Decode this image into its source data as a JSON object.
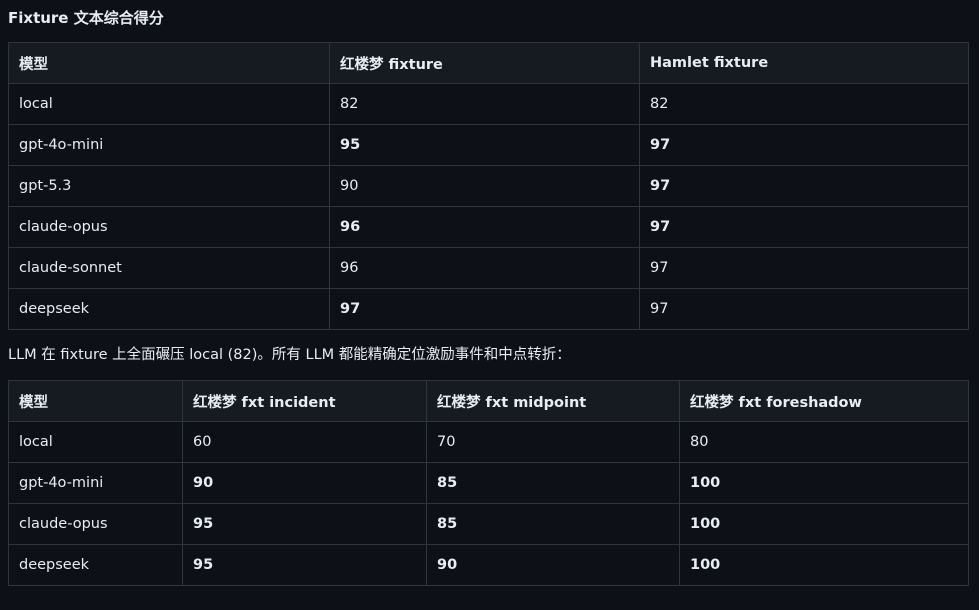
{
  "heading": "Fixture 文本综合得分",
  "table1": {
    "headers": [
      "模型",
      "红楼梦 fixture",
      "Hamlet fixture"
    ],
    "rows": [
      [
        {
          "v": "local",
          "b": false
        },
        {
          "v": "82",
          "b": false
        },
        {
          "v": "82",
          "b": false
        }
      ],
      [
        {
          "v": "gpt-4o-mini",
          "b": false
        },
        {
          "v": "95",
          "b": true
        },
        {
          "v": "97",
          "b": true
        }
      ],
      [
        {
          "v": "gpt-5.3",
          "b": false
        },
        {
          "v": "90",
          "b": false
        },
        {
          "v": "97",
          "b": true
        }
      ],
      [
        {
          "v": "claude-opus",
          "b": false
        },
        {
          "v": "96",
          "b": true
        },
        {
          "v": "97",
          "b": true
        }
      ],
      [
        {
          "v": "claude-sonnet",
          "b": false
        },
        {
          "v": "96",
          "b": false
        },
        {
          "v": "97",
          "b": false
        }
      ],
      [
        {
          "v": "deepseek",
          "b": false
        },
        {
          "v": "97",
          "b": true
        },
        {
          "v": "97",
          "b": false
        }
      ]
    ]
  },
  "note": "LLM 在 fixture 上全面碾压 local (82)。所有 LLM 都能精确定位激励事件和中点转折：",
  "table2": {
    "headers": [
      "模型",
      "红楼梦 fxt incident",
      "红楼梦 fxt midpoint",
      "红楼梦 fxt foreshadow"
    ],
    "rows": [
      [
        {
          "v": "local",
          "b": false
        },
        {
          "v": "60",
          "b": false
        },
        {
          "v": "70",
          "b": false
        },
        {
          "v": "80",
          "b": false
        }
      ],
      [
        {
          "v": "gpt-4o-mini",
          "b": false
        },
        {
          "v": "90",
          "b": true
        },
        {
          "v": "85",
          "b": true
        },
        {
          "v": "100",
          "b": true
        }
      ],
      [
        {
          "v": "claude-opus",
          "b": false
        },
        {
          "v": "95",
          "b": true
        },
        {
          "v": "85",
          "b": true
        },
        {
          "v": "100",
          "b": true
        }
      ],
      [
        {
          "v": "deepseek",
          "b": false
        },
        {
          "v": "95",
          "b": true
        },
        {
          "v": "90",
          "b": true
        },
        {
          "v": "100",
          "b": true
        }
      ]
    ]
  },
  "colors": {
    "background": "#0d1117",
    "header_background": "#161b22",
    "border": "#30363d",
    "text": "#e6edf3"
  }
}
